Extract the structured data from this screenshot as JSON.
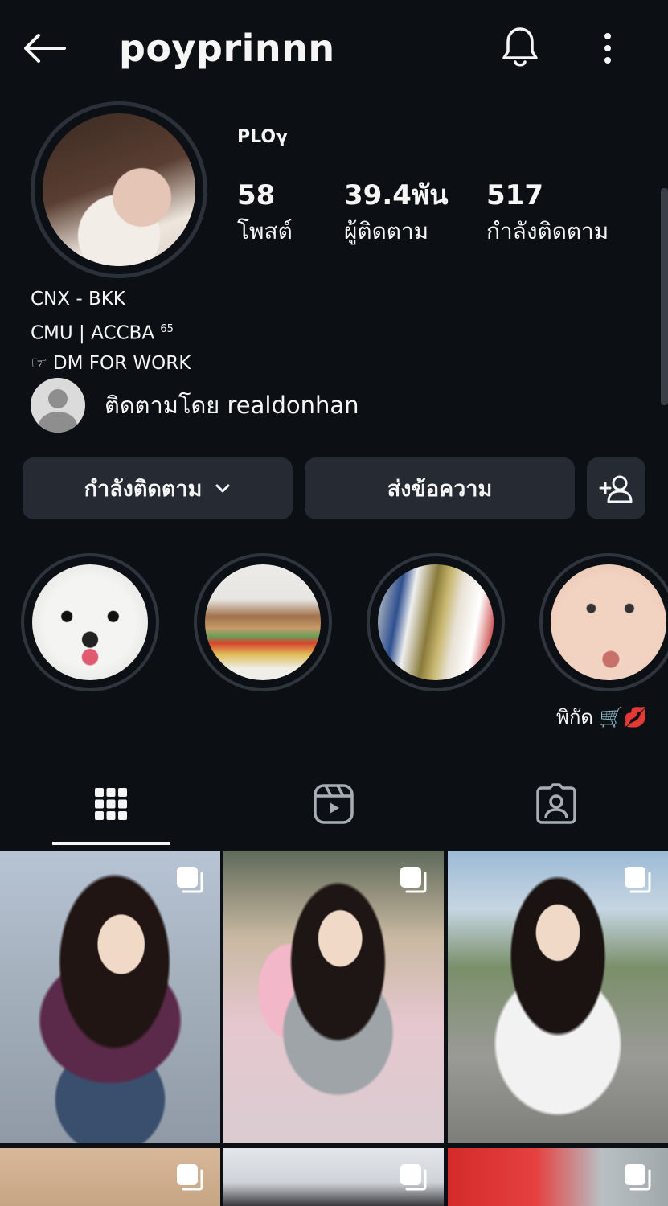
{
  "header": {
    "username": "poyprinnn",
    "back_icon": "arrow-left-icon",
    "bell_icon": "bell-icon",
    "more_icon": "more-vertical-icon"
  },
  "profile": {
    "display_name": "PLOγ",
    "stats": [
      {
        "value": "58",
        "label": "โพสต์"
      },
      {
        "value": "39.4พัน",
        "label": "ผู้ติดตาม"
      },
      {
        "value": "517",
        "label": "กำลังติดตาม"
      }
    ],
    "bio": {
      "line1": "CNX - BKK",
      "line2": "CMU | ACCBA",
      "line2_sup": "65",
      "line3": "☞ DM FOR WORK"
    },
    "followed_by": "ติดตามโดย realdonhan"
  },
  "actions": {
    "following_label": "กำลังติดตาม",
    "message_label": "ส่งข้อความ"
  },
  "highlights": [
    {
      "label": ""
    },
    {
      "label": ""
    },
    {
      "label": ""
    },
    {
      "label": "พิกัด 🛒💋"
    }
  ],
  "tabs": [
    {
      "icon": "grid-icon",
      "active": true
    },
    {
      "icon": "reels-icon",
      "active": false
    },
    {
      "icon": "tagged-icon",
      "active": false
    }
  ],
  "colors": {
    "background": "#0c1014",
    "button": "#262a32",
    "text": "#f5f5f5"
  }
}
